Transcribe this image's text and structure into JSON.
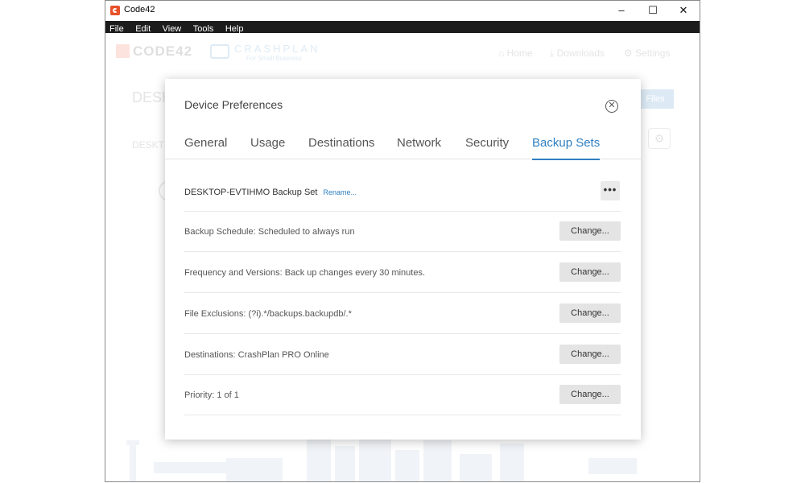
{
  "window": {
    "title": "Code42",
    "controls": {
      "minimize": "–",
      "maximize": "☐",
      "close": "✕"
    }
  },
  "menu": [
    "File",
    "Edit",
    "View",
    "Tools",
    "Help"
  ],
  "background": {
    "logo_text": "CODE42",
    "product_text": "CRASHPLAN",
    "product_sub": "For Small Business",
    "nav": {
      "home": "Home",
      "downloads": "Downloads",
      "settings": "Settings"
    },
    "heading": "DESK",
    "subheading": "DESKT",
    "button": "Files"
  },
  "modal": {
    "title": "Device Preferences",
    "tabs": [
      "General",
      "Usage",
      "Destinations",
      "Network",
      "Security",
      "Backup Sets"
    ],
    "active_tab": "Backup Sets",
    "backup_set": {
      "name": "DESKTOP-EVTIHMO Backup Set",
      "rename": "Rename..."
    },
    "more_label": "•••",
    "rows": [
      {
        "label": "Backup Schedule:",
        "value": "Scheduled to always run",
        "button": "Change..."
      },
      {
        "label": "Frequency and Versions:",
        "value": "Back up changes every 30 minutes.",
        "button": "Change..."
      },
      {
        "label": "File Exclusions:",
        "value": "(?i).*/backups.backupdb/.*",
        "button": "Change..."
      },
      {
        "label": "Destinations:",
        "value": "CrashPlan PRO Online",
        "button": "Change..."
      },
      {
        "label": "Priority:",
        "value": "1 of 1",
        "button": "Change..."
      }
    ]
  },
  "colors": {
    "accent": "#2f7fc1",
    "brand": "#e8512a",
    "menubar": "#1c1c1c"
  }
}
